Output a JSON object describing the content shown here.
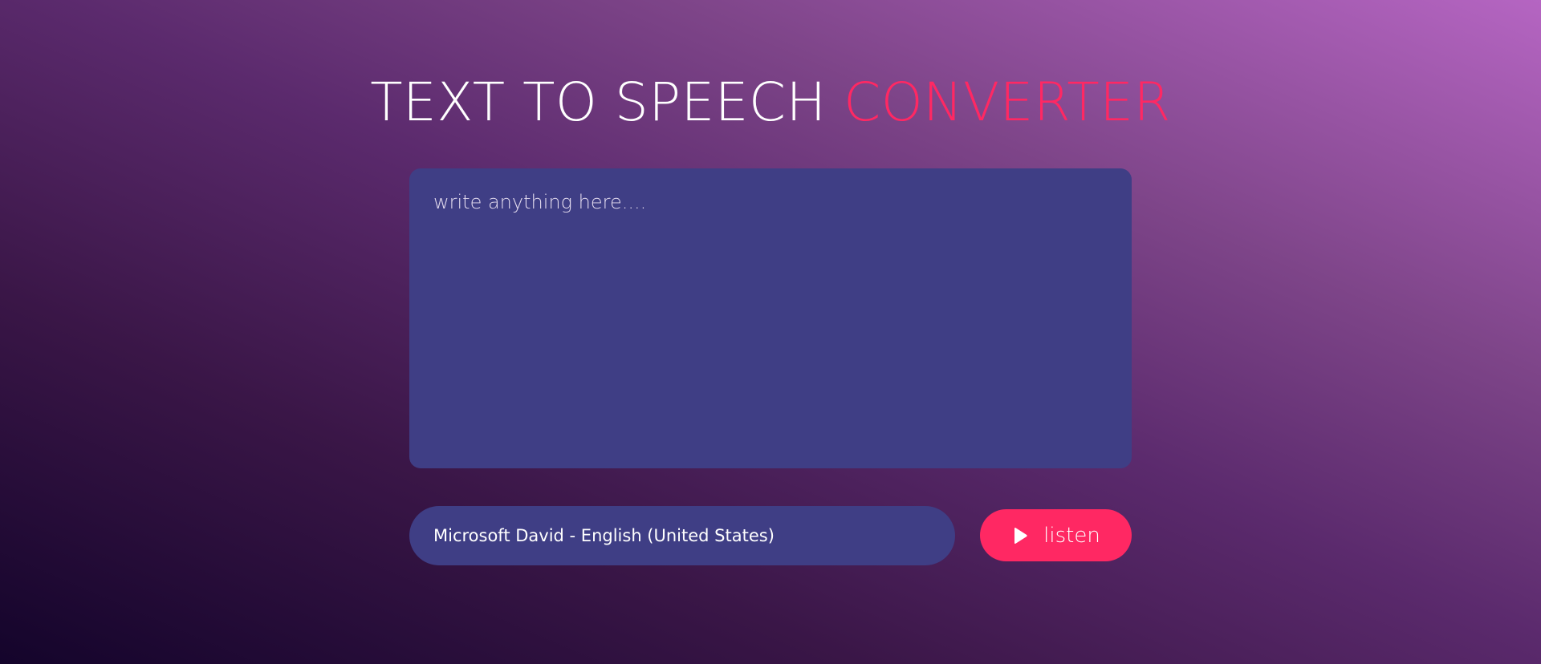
{
  "header": {
    "title_main": "TEXT TO SPEECH",
    "title_accent": "CONVERTER"
  },
  "textarea": {
    "placeholder": "write anything here....",
    "value": ""
  },
  "voice_select": {
    "selected": "Microsoft David - English (United States)"
  },
  "listen_button": {
    "label": "listen",
    "icon": "play-icon"
  },
  "colors": {
    "accent": "#ff2863",
    "panel": "#3f3e85"
  }
}
